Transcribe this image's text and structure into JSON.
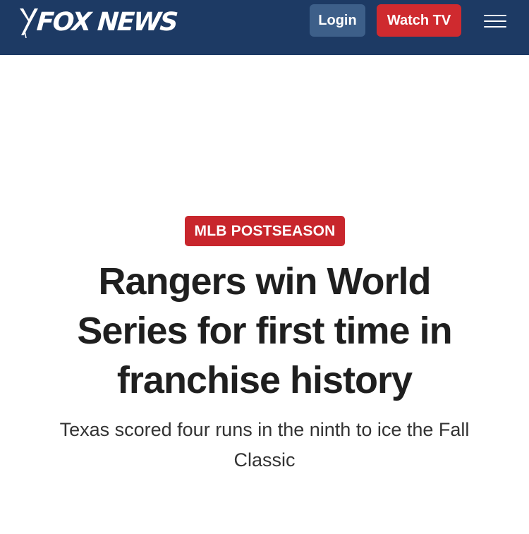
{
  "header": {
    "logo_text": "FOX NEWS",
    "login_label": "Login",
    "watch_label": "Watch TV",
    "colors": {
      "background": "#1d3a64",
      "login_button": "#3d5f89",
      "watch_button": "#cf2a2f"
    }
  },
  "article": {
    "category": "MLB POSTSEASON",
    "headline": "Rangers win World Series for first time in franchise history",
    "subheadline": "Texas scored four runs in the ninth to ice the Fall Classic",
    "category_color": "#c8262c"
  },
  "icons": {
    "logo": "fox-news-logo-icon",
    "menu": "hamburger-menu-icon"
  }
}
